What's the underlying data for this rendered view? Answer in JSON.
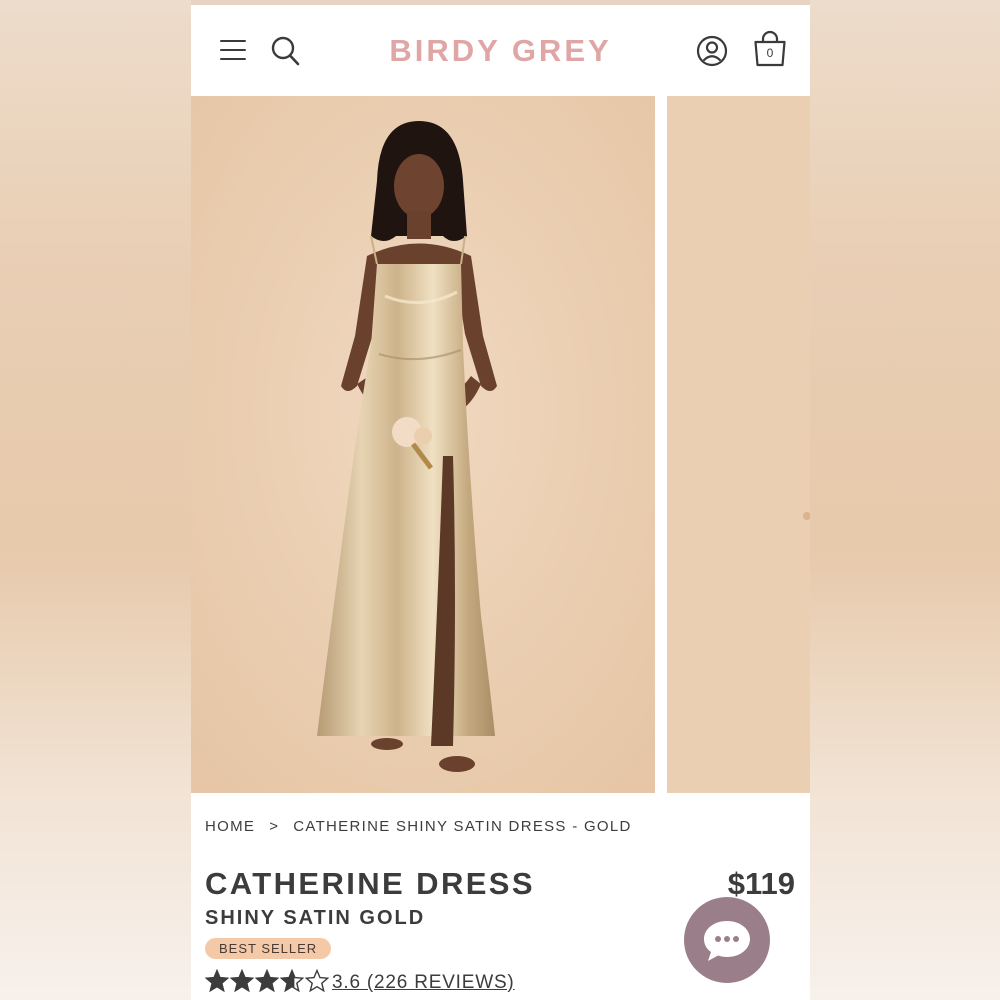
{
  "brand": {
    "logo_text": "BIRDY GREY",
    "logo_color": "#e0a6a6"
  },
  "header": {
    "menu_icon": "menu-icon",
    "search_icon": "search-icon",
    "account_icon": "account-icon",
    "cart_icon": "shopping-bag-icon",
    "cart_count": "0"
  },
  "gallery": {
    "images": [
      "Catherine dress front view",
      "Catherine dress second view"
    ],
    "background_color": "#ecd0b4"
  },
  "breadcrumb": {
    "home": "HOME",
    "separator": ">",
    "current": "CATHERINE SHINY SATIN DRESS - GOLD"
  },
  "product": {
    "name": "CATHERINE DRESS",
    "subtitle": "SHINY SATIN GOLD",
    "price": "$119",
    "badge": "BEST SELLER",
    "badge_color": "#f3c9a8",
    "rating": 3.6,
    "rating_max": 5,
    "reviews_label": "3.6 (226 REVIEWS)"
  },
  "chat": {
    "icon": "chat-bubble-icon",
    "color": "#9a7f8a"
  }
}
